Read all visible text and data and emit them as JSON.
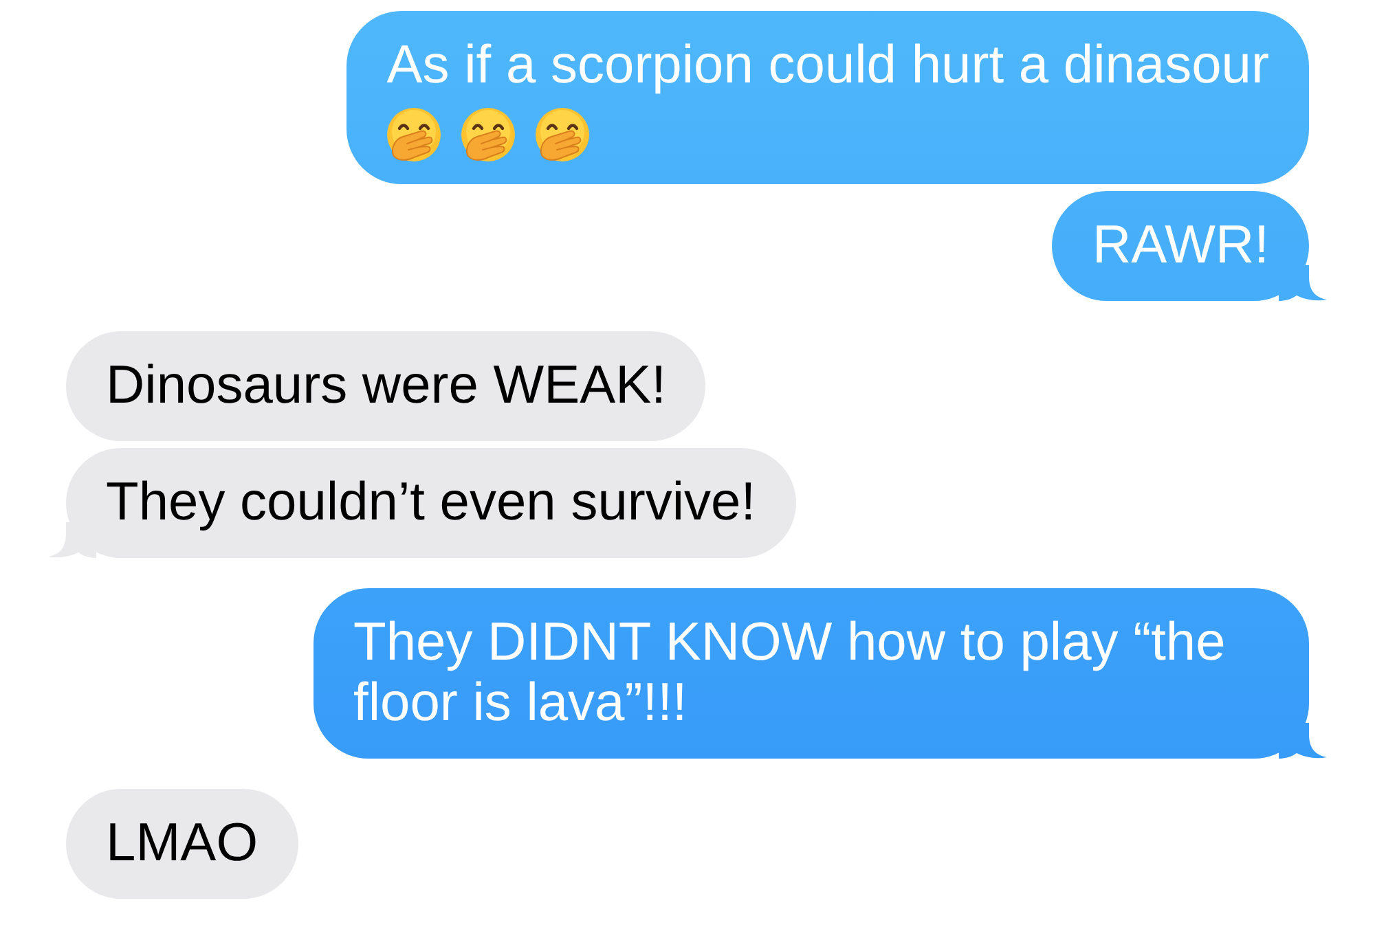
{
  "conversation": [
    {
      "kind": "sent",
      "messages": [
        {
          "text": "As if a scorpion could hurt a dinasour",
          "emojis": [
            {
              "kind": "giggle"
            },
            {
              "kind": "giggle"
            },
            {
              "kind": "giggle"
            }
          ],
          "tail": false
        },
        {
          "text": "RAWR!",
          "tail": true
        }
      ]
    },
    {
      "kind": "received",
      "messages": [
        {
          "text": "Dinosaurs were WEAK!",
          "tail": false
        },
        {
          "text": "They couldn’t even survive!",
          "tail": true
        }
      ]
    },
    {
      "kind": "sent",
      "messages": [
        {
          "text": "They DIDNT KNOW how to play “the floor is lava”!!!",
          "tail": true
        }
      ]
    },
    {
      "kind": "received",
      "messages": [
        {
          "text": "LMAO",
          "tail": false
        }
      ]
    }
  ]
}
